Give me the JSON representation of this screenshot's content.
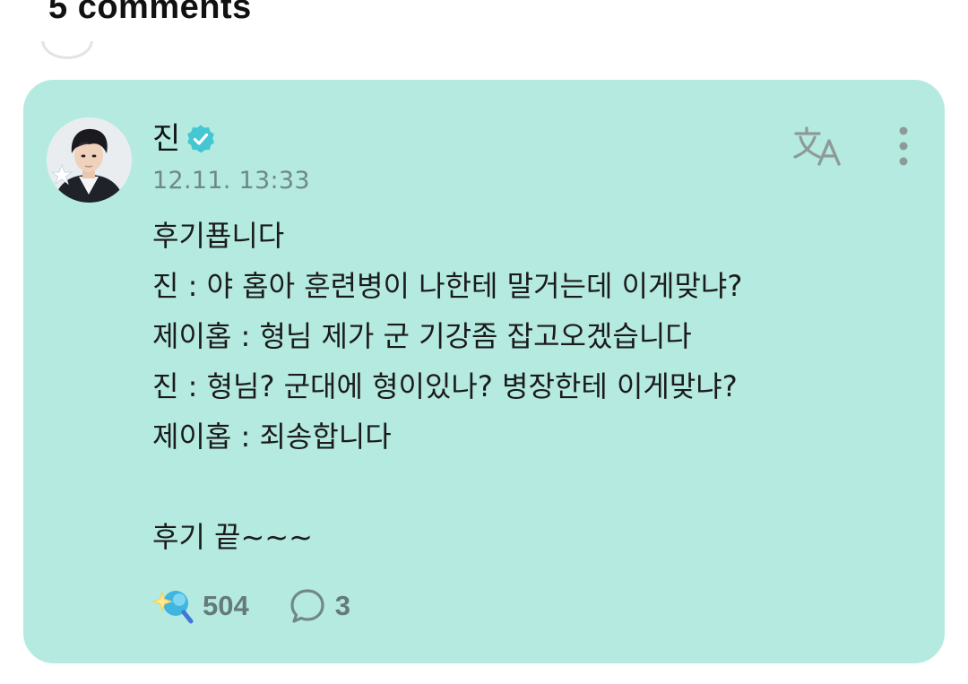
{
  "header": {
    "comments_title": "5 comments"
  },
  "comment": {
    "author": "진",
    "verified": true,
    "timestamp": "12.11. 13:33",
    "lines": [
      "후기푭니다",
      "진 : 야 홉아 훈련병이 나한테 말거는데 이게맞냐?",
      "제이홉 : 형님 제가 군 기강좀 잡고오겠습니다",
      "진 : 형님? 군대에 형이있나? 병장한테 이게맞냐?",
      "제이홉 : 죄송합니다",
      "",
      "후기 끝~~~"
    ],
    "like_count": "504",
    "reply_count": "3"
  },
  "icons": {
    "translate": "translate-icon",
    "more": "more-vertical-icon",
    "verified": "verified-badge-icon",
    "like": "sparkle-like-icon",
    "reply": "speech-bubble-icon"
  },
  "colors": {
    "card_background": "#b4eae0",
    "verified_badge": "#45c6d3",
    "muted_text": "#6f8985",
    "count_text": "#657b79",
    "icon_gray": "#8e9a98"
  }
}
